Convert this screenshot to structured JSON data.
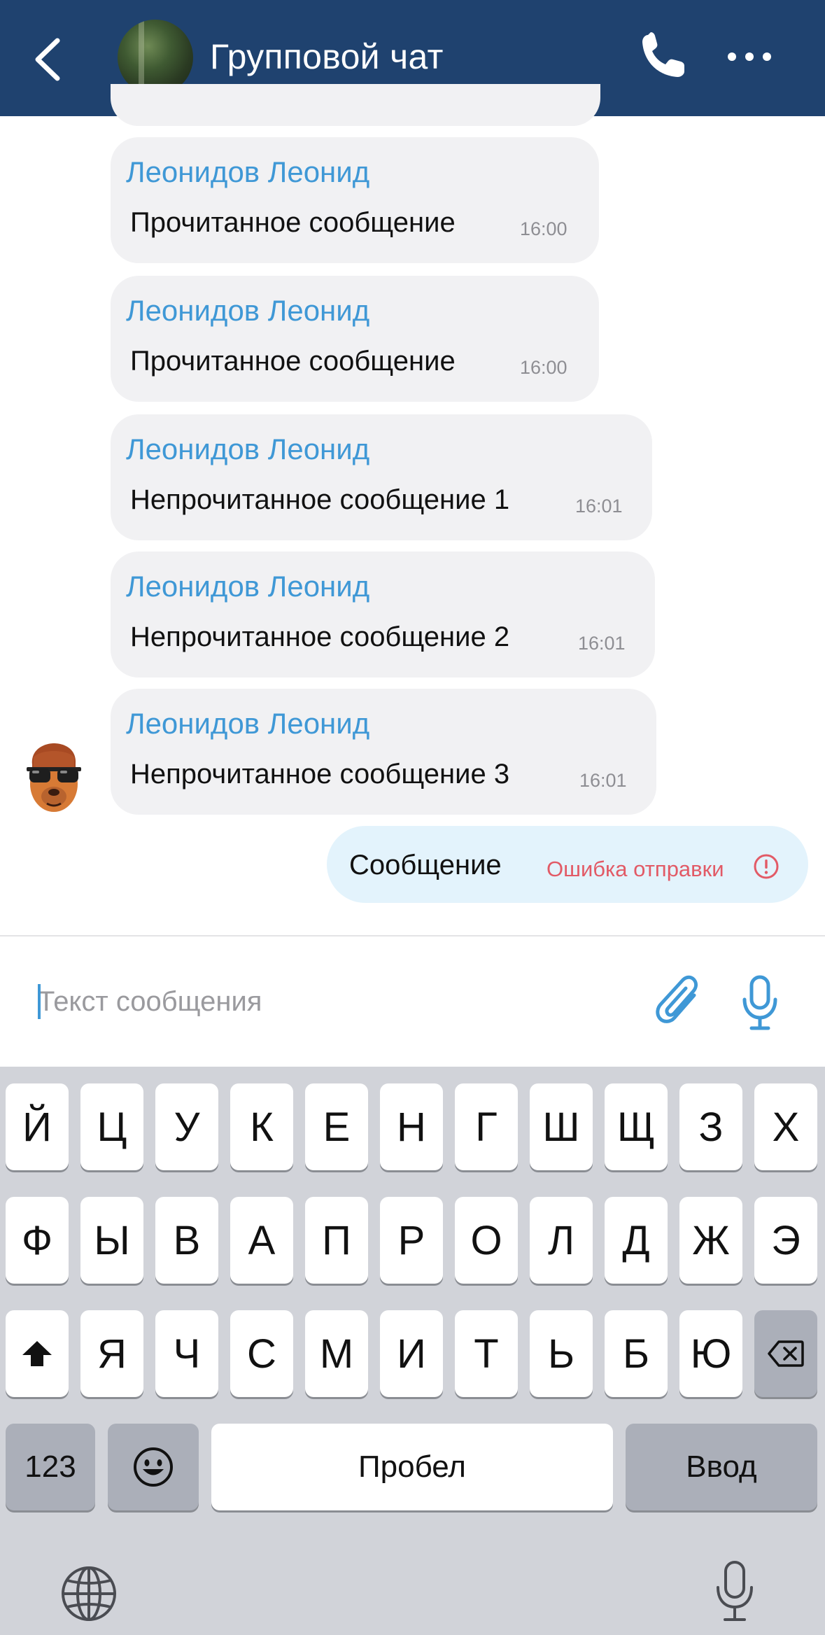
{
  "header": {
    "title": "Групповой чат",
    "colors": {
      "background": "#1f426f",
      "text": "#ffffff"
    }
  },
  "messages": [
    {
      "author": "Леонидов Леонид",
      "text": "Прочитанное сообщение",
      "time": "16:00"
    },
    {
      "author": "Леонидов Леонид",
      "text": "Прочитанное сообщение",
      "time": "16:00"
    },
    {
      "author": "Леонидов Леонид",
      "text": "Непрочитанное сообщение 1",
      "time": "16:01"
    },
    {
      "author": "Леонидов Леонид",
      "text": "Непрочитанное сообщение 2",
      "time": "16:01"
    },
    {
      "author": "Леонидов Леонид",
      "text": "Непрочитанное сообщение 3",
      "time": "16:01"
    }
  ],
  "outgoing": {
    "text": "Сообщение",
    "error": "Ошибка отправки"
  },
  "composer": {
    "placeholder": "Текст сообщения"
  },
  "keyboard": {
    "row1": [
      "Й",
      "Ц",
      "У",
      "К",
      "Е",
      "Н",
      "Г",
      "Ш",
      "Щ",
      "З",
      "Х"
    ],
    "row2": [
      "Ф",
      "Ы",
      "В",
      "А",
      "П",
      "Р",
      "О",
      "Л",
      "Д",
      "Ж",
      "Э"
    ],
    "row3": [
      "Я",
      "Ч",
      "С",
      "М",
      "И",
      "Т",
      "Ь",
      "Б",
      "Ю"
    ],
    "numbers": "123",
    "space": "Пробел",
    "enter": "Ввод"
  },
  "colors": {
    "author": "#3f98d6",
    "bubble": "#f1f1f3",
    "outgoing_bubble": "#e3f3fc",
    "error": "#e25a66",
    "keyboard_bg": "#d1d3d9"
  }
}
